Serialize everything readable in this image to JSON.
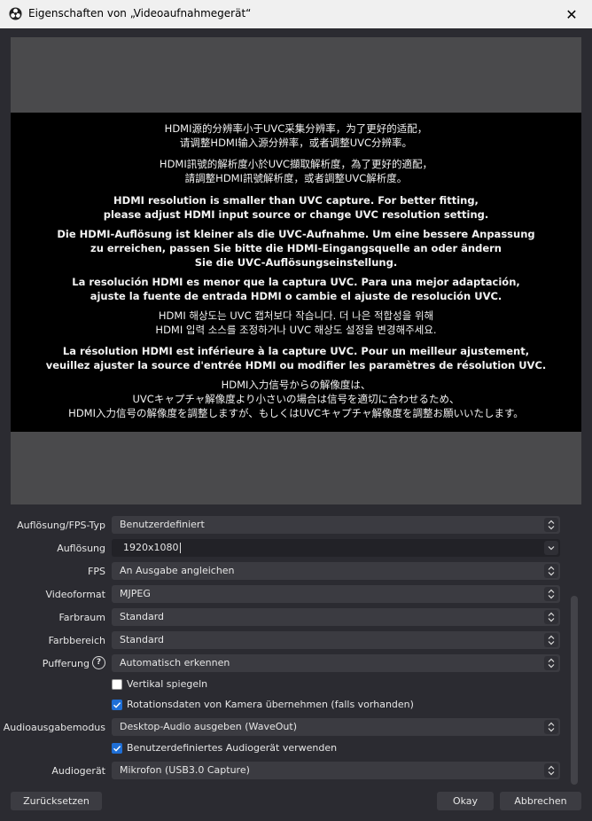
{
  "window": {
    "title": "Eigenschaften von „Videoaufnahmegerät“"
  },
  "preview": {
    "messages": [
      {
        "text": "HDMI源的分辨率小于UVC采集分辨率，为了更好的适配，\n请调整HDMI输入源分辨率，或者调整UVC分辨率。",
        "bold": false
      },
      {
        "text": "HDMI訊號的解析度小於UVC擷取解析度，為了更好的適配，\n請調整HDMI訊號解析度，或者調整UVC解析度。",
        "bold": false
      },
      {
        "text": "HDMI resolution is smaller than UVC capture. For better fitting,\nplease adjust HDMI input source or change UVC resolution setting.",
        "bold": true
      },
      {
        "text": "Die HDMI-Auflösung ist kleiner als die UVC-Aufnahme. Um eine bessere Anpassung\nzu erreichen, passen Sie bitte die HDMI-Eingangsquelle an oder ändern\nSie die UVC-Auflösungseinstellung.",
        "bold": true
      },
      {
        "text": "La resolución HDMI es menor que la captura UVC. Para una mejor adaptación,\najuste la fuente de entrada HDMI o cambie el ajuste de resolución UVC.",
        "bold": true
      },
      {
        "text": "HDMI 해상도는 UVC 캡처보다 작습니다. 더 나은 적합성을 위해\nHDMI 입력 소스를 조정하거나 UVC 해상도 설정을 변경해주세요.",
        "bold": false
      },
      {
        "text": "La résolution HDMI est inférieure à la capture UVC. Pour un meilleur ajustement,\nveuillez ajuster la source d'entrée HDMI ou modifier les paramètres de résolution UVC.",
        "bold": true
      },
      {
        "text": "HDMI入力信号からの解像度は、\nUVCキャプチャ解像度より小さいの場合は信号を適切に合わせるため、\nHDMI入力信号の解像度を調整しますが、もしくはUVCキャプチャ解像度を調整お願いいたします。",
        "bold": false
      }
    ]
  },
  "settings": {
    "resolution_fps_type": {
      "label": "Auflösung/FPS-Typ",
      "value": "Benutzerdefiniert"
    },
    "resolution": {
      "label": "Auflösung",
      "value": "1920x1080"
    },
    "fps": {
      "label": "FPS",
      "value": "An Ausgabe angleichen"
    },
    "video_format": {
      "label": "Videoformat",
      "value": "MJPEG"
    },
    "color_space": {
      "label": "Farbraum",
      "value": "Standard"
    },
    "color_range": {
      "label": "Farbbereich",
      "value": "Standard"
    },
    "buffering": {
      "label": "Pufferung",
      "value": "Automatisch erkennen",
      "help": "?"
    },
    "flip_vertical": {
      "label": "Vertikal spiegeln",
      "checked": false
    },
    "rotation_data": {
      "label": "Rotationsdaten von Kamera übernehmen (falls vorhanden)",
      "checked": true
    },
    "audio_output_mode": {
      "label": "Audioausgabemodus",
      "value": "Desktop-Audio ausgeben (WaveOut)"
    },
    "custom_audio_device": {
      "label": "Benutzerdefiniertes Audiogerät verwenden",
      "checked": true
    },
    "audio_device": {
      "label": "Audiogerät",
      "value": "Mikrofon (USB3.0 Capture)"
    }
  },
  "buttons": {
    "reset": "Zurücksetzen",
    "ok": "Okay",
    "cancel": "Abbrechen"
  },
  "icons": {
    "app": "obs-logo-icon",
    "close": "close-icon",
    "combo": "updown-chevron-icon",
    "dropdown": "chevron-down-icon",
    "check": "checkmark-icon"
  }
}
